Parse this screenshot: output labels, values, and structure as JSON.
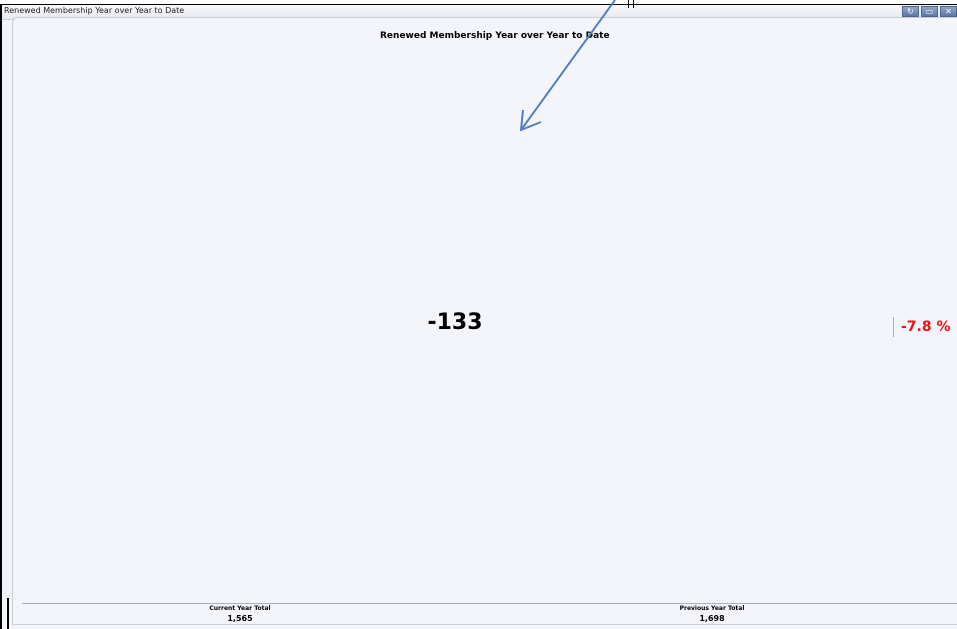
{
  "window": {
    "title": "Renewed Membership Year over Year to Date",
    "buttons": [
      "refresh-icon",
      "restore-icon",
      "close-icon"
    ],
    "button_glyphs": [
      "↻",
      "▭",
      "✕"
    ]
  },
  "widget": {
    "title": "Renewed Membership Year over Year to Date",
    "kpi_value": "-133",
    "kpi_percent": "-7.8 %",
    "kpi_percent_color": "#ee1111",
    "footer": {
      "current_label": "Current Year Total",
      "current_value": "1,565",
      "previous_label": "Previous Year Total",
      "previous_value": "1,698"
    }
  },
  "annotation": {
    "type": "arrow",
    "color": "#4f81bd"
  }
}
